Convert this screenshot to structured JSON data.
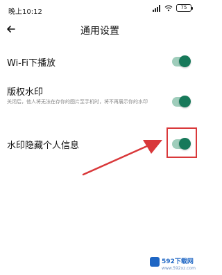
{
  "status_bar": {
    "time": "晚上10:12",
    "battery": "75"
  },
  "header": {
    "title": "通用设置"
  },
  "settings": [
    {
      "label": "Wi-Fi下播放",
      "enabled": true
    },
    {
      "label": "版权水印",
      "description": "关闭后，他人将无法在存你的图片至手机时，将不再展示你的水印",
      "enabled": true
    },
    {
      "label": "水印隐藏个人信息",
      "enabled": true
    }
  ],
  "annotation": {
    "color": "#d9383a"
  },
  "watermark": {
    "name": "592下载网",
    "url": "www.592xz.com"
  },
  "colors": {
    "toggle_track": "#9fcdbb",
    "toggle_knob": "#17795a"
  }
}
